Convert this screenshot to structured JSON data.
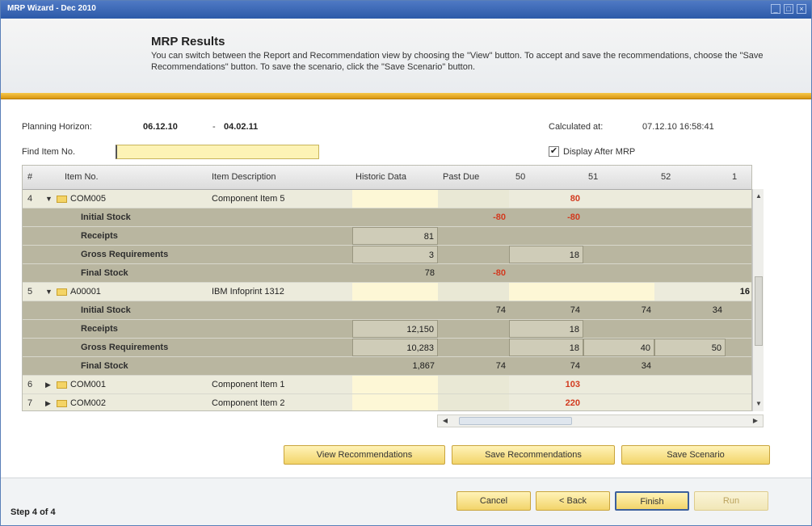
{
  "window": {
    "title": "MRP Wizard - Dec 2010",
    "controls": [
      "_",
      "□",
      "×"
    ]
  },
  "header": {
    "title": "MRP Results",
    "description": "You can switch between the Report and Recommendation view by choosing the \"View\" button. To accept and save the recommendations, choose the \"Save Recommendations\" button. To save the scenario, click the \"Save Scenario\" button."
  },
  "filters": {
    "planning_horizon_label": "Planning Horizon:",
    "planning_from": "06.12.10",
    "planning_sep": "-",
    "planning_to": "04.02.11",
    "calculated_label": "Calculated at:",
    "calculated_value": "07.12.10  16:58:41",
    "find_label": "Find Item No.",
    "find_value": "",
    "display_after_label": "Display After MRP",
    "display_after_checked": "✔"
  },
  "grid": {
    "columns": [
      "#",
      "Item No.",
      "Item Description",
      "Historic Data",
      "Past Due",
      "50",
      "51",
      "52",
      "1"
    ],
    "rows": [
      {
        "num": "4",
        "code": "COM005",
        "desc": "Component Item 5",
        "hist": "",
        "past": "",
        "c50": "80",
        "c51": "",
        "c52": "",
        "c1": "",
        "expanded": "▼"
      },
      {
        "label": "Initial Stock",
        "hist": "",
        "past": "-80",
        "c50": "-80",
        "c51": "",
        "c52": "",
        "c1": ""
      },
      {
        "label": "Receipts",
        "hist": "81",
        "past": "",
        "c50": "",
        "c51": "",
        "c52": "",
        "c1": ""
      },
      {
        "label": "Gross Requirements",
        "hist": "3",
        "past": "",
        "c50": "18",
        "c51": "",
        "c52": "",
        "c1": ""
      },
      {
        "label": "Final Stock",
        "hist": "78",
        "past": "-80",
        "c50": "",
        "c51": "",
        "c52": "",
        "c1": ""
      },
      {
        "num": "5",
        "code": "A00001",
        "desc": "IBM Infoprint 1312",
        "hist": "",
        "past": "",
        "c50": "",
        "c51": "",
        "c52": "",
        "c1": "16",
        "expanded": "▼"
      },
      {
        "label": "Initial Stock",
        "hist": "",
        "past": "74",
        "c50": "74",
        "c51": "74",
        "c52": "34",
        "c1": ""
      },
      {
        "label": "Receipts",
        "hist": "12,150",
        "past": "",
        "c50": "18",
        "c51": "",
        "c52": "",
        "c1": ""
      },
      {
        "label": "Gross Requirements",
        "hist": "10,283",
        "past": "",
        "c50": "18",
        "c51": "40",
        "c52": "50",
        "c1": ""
      },
      {
        "label": "Final Stock",
        "hist": "1,867",
        "past": "74",
        "c50": "74",
        "c51": "34",
        "c52": "",
        "c1": ""
      },
      {
        "num": "6",
        "code": "COM001",
        "desc": "Component Item 1",
        "hist": "",
        "past": "",
        "c50": "103",
        "c51": "",
        "c52": "",
        "c1": "",
        "expanded": "▶"
      },
      {
        "num": "7",
        "code": "COM002",
        "desc": "Component Item 2",
        "hist": "",
        "past": "",
        "c50": "220",
        "c51": "",
        "c52": "",
        "c1": "",
        "expanded": "▶"
      }
    ]
  },
  "actions": {
    "view_recommendations": "View Recommendations",
    "save_recommendations": "Save Recommendations",
    "save_scenario": "Save Scenario"
  },
  "footer": {
    "step": "Step 4 of 4",
    "cancel": "Cancel",
    "back": "< Back",
    "finish": "Finish",
    "run": "Run"
  },
  "colors": {
    "accent_gold": "#f2d46a",
    "title_blue": "#2c5aa8",
    "negative_red": "#d23a1f"
  }
}
